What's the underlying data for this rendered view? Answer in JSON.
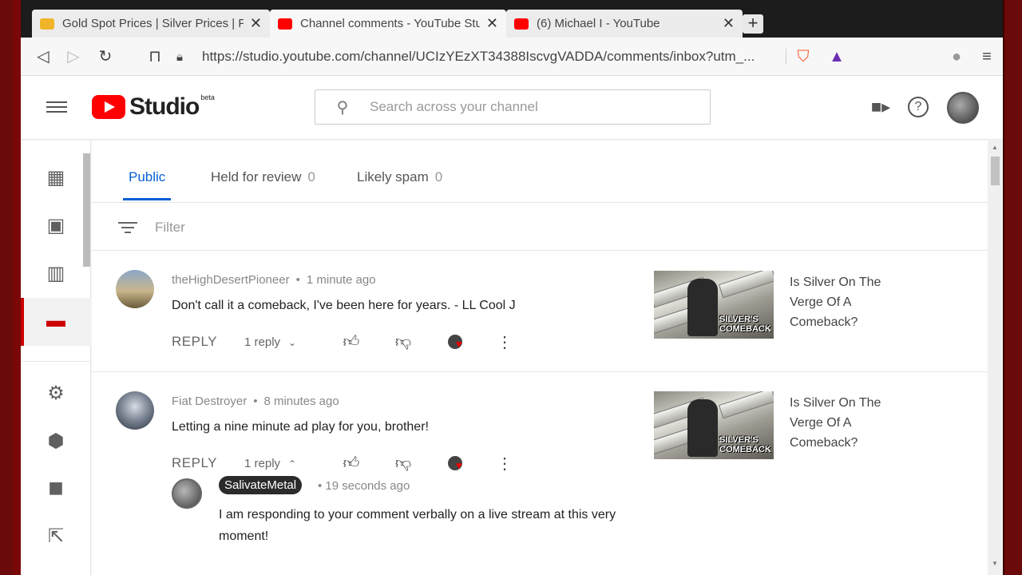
{
  "browser": {
    "tabs": [
      {
        "title": "Gold Spot Prices | Silver Prices | Pla",
        "favicon_color": "#f0b429"
      },
      {
        "title": "Channel comments - YouTube Stu",
        "favicon_color": "#ff0000"
      },
      {
        "title": "(6) Michael I - YouTube",
        "favicon_color": "#ff0000"
      }
    ],
    "new_tab": "+",
    "url": "https://studio.youtube.com/channel/UCIzYEzXT34388IscvgVADDA/comments/inbox?utm_..."
  },
  "studio": {
    "logo_text": "Studio",
    "beta": "beta",
    "search_placeholder": "Search across your channel"
  },
  "comment_tabs": [
    {
      "label": "Public",
      "count": ""
    },
    {
      "label": "Held for review",
      "count": "0"
    },
    {
      "label": "Likely spam",
      "count": "0"
    }
  ],
  "filter_label": "Filter",
  "comments": [
    {
      "author": "theHighDesertPioneer",
      "time": "1 minute ago",
      "text": "Don't call it a comeback, I've been here for years. - LL Cool J",
      "reply_label": "REPLY",
      "replies": "1 reply",
      "video_title": "Is Silver On The Verge Of A Comeback?",
      "thumb_caption": "SILVER'S COMEBACK"
    },
    {
      "author": "Fiat Destroyer",
      "time": "8 minutes ago",
      "text": "Letting a nine minute ad play for you, brother!",
      "reply_label": "REPLY",
      "replies": "1 reply",
      "video_title": "Is Silver On The Verge Of A Comeback?",
      "thumb_caption": "SILVER'S COMEBACK",
      "reply": {
        "author": "SalivateMetal",
        "time": "19 seconds ago",
        "text": "I am responding to your comment verbally on a live stream at this very moment!"
      }
    }
  ],
  "colors": {
    "accent": "#065fd4",
    "active_nav": "#cc0000",
    "youtube_red": "#ff0000"
  }
}
